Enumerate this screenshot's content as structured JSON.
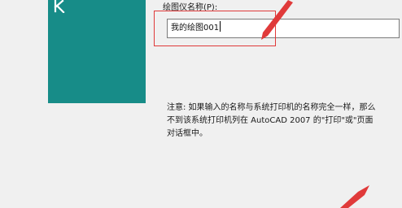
{
  "dialog": {
    "name_label": "绘图仪名称(P):",
    "name_value": "我的绘图001",
    "note_text": "注意: 如果输入的名称与系统打印机的名称完全一样，那么\n不到该系统打印机列在 AutoCAD 2007 的\"打印\"或\"页面\n对话框中。"
  },
  "colors": {
    "banner": "#178c88",
    "highlight": "#e03a3a"
  },
  "icons": {
    "banner_logo": "autocad-logo-icon"
  }
}
